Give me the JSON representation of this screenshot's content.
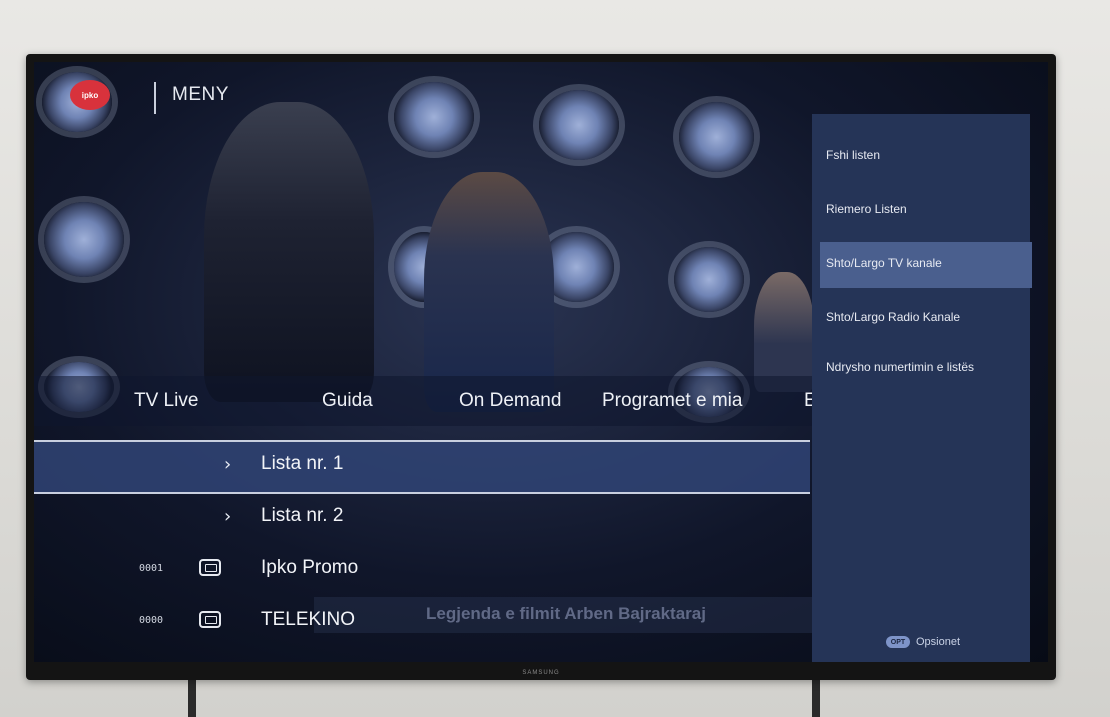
{
  "header": {
    "logo_text": "ipko",
    "title": "MENY"
  },
  "tabs": [
    {
      "label": "TV Live"
    },
    {
      "label": "Guida"
    },
    {
      "label": "On Demand"
    },
    {
      "label": "Programet e mia"
    },
    {
      "label": "E"
    }
  ],
  "list": {
    "rows": [
      {
        "type": "folder",
        "label": "Lista nr. 1",
        "selected": true
      },
      {
        "type": "folder",
        "label": "Lista nr. 2",
        "selected": false
      },
      {
        "type": "channel",
        "number": "0001",
        "label": "Ipko Promo",
        "icon": "tv-icon"
      },
      {
        "type": "channel",
        "number": "0000",
        "label": "TELEKINO",
        "icon": "tv-icon"
      }
    ]
  },
  "caption": "Legjenda e filmit Arben Bajraktaraj",
  "options_panel": {
    "items": [
      {
        "label": "Fshi listen",
        "highlighted": false
      },
      {
        "label": "Riemero Listen",
        "highlighted": false
      },
      {
        "label": "Shto/Largo TV kanale",
        "highlighted": true
      },
      {
        "label": "Shto/Largo Radio Kanale",
        "highlighted": false
      },
      {
        "label": "Ndrysho numertimin e listës",
        "highlighted": false
      }
    ],
    "footer_badge": "OPT",
    "footer_label": "Opsionet"
  },
  "tv_brand": "SAMSUNG",
  "colors": {
    "panel": "#253457",
    "highlight": "#4a5f8e",
    "logo": "#d8323c"
  }
}
